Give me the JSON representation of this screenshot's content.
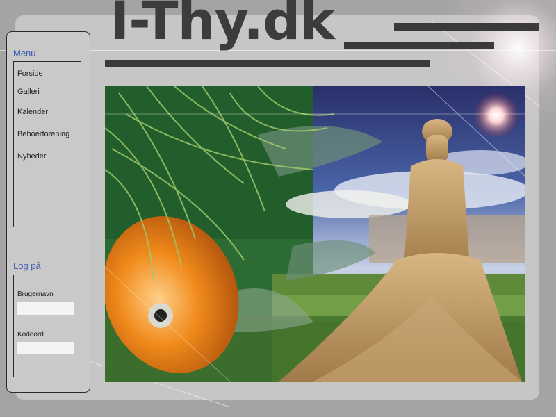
{
  "site": {
    "logo_text": "I-Thy.dk"
  },
  "menu": {
    "title": "Menu",
    "items": [
      {
        "label": "Forside"
      },
      {
        "label": "Galleri"
      },
      {
        "label": "Kalender"
      },
      {
        "label": "Beboerforening"
      },
      {
        "label": "Nyheder"
      }
    ]
  },
  "login": {
    "title": "Log på",
    "username_label": "Brugernavn",
    "username_value": "",
    "password_label": "Kodeord",
    "password_value": ""
  },
  "colors": {
    "accent_text": "#3d5bb0",
    "logo": "#3c3c3c",
    "panel": "#c6c6c6",
    "page_bg": "#a4a4a4"
  }
}
